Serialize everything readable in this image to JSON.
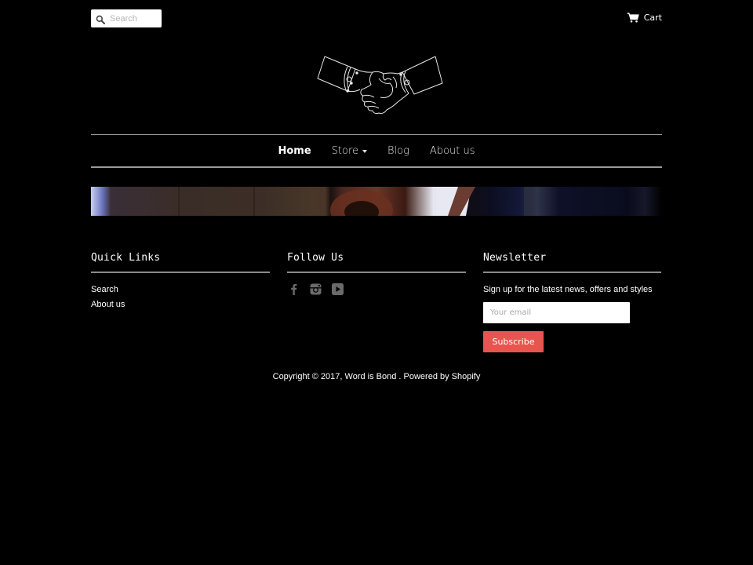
{
  "header": {
    "search": {
      "icon": "search-icon",
      "placeholder": "Search",
      "value": ""
    },
    "cart": {
      "icon": "cart-icon",
      "label": "Cart"
    },
    "logo": {
      "icon": "handshake-logo",
      "alt": "Word is Bond"
    }
  },
  "nav": {
    "items": [
      {
        "label": "Home",
        "active": true
      },
      {
        "label": "Store",
        "has_dropdown": true
      },
      {
        "label": "Blog"
      },
      {
        "label": "About us"
      }
    ]
  },
  "banner": {
    "alt": "Banner image"
  },
  "footer": {
    "quick_links": {
      "heading": "Quick Links",
      "links": [
        {
          "label": "Search"
        },
        {
          "label": "About us"
        }
      ]
    },
    "follow_us": {
      "heading": "Follow Us",
      "icons": [
        "facebook-icon",
        "instagram-icon",
        "youtube-icon"
      ],
      "icon_color": "#6a6a6a"
    },
    "newsletter": {
      "heading": "Newsletter",
      "text": "Sign up for the latest news, offers and styles",
      "email_placeholder": "Your email",
      "email_value": "",
      "subscribe_label": "Subscribe",
      "subscribe_color": "#e8554e"
    },
    "copyright": {
      "prefix": "Copyright © 2017, ",
      "store_name": "Word is Bond",
      "separator": " . ",
      "powered_by": "Powered by Shopify"
    }
  },
  "colors": {
    "background": "#000000",
    "text": "#ffffff",
    "divider": "#9a9a9a",
    "accent": "#e8554e"
  }
}
